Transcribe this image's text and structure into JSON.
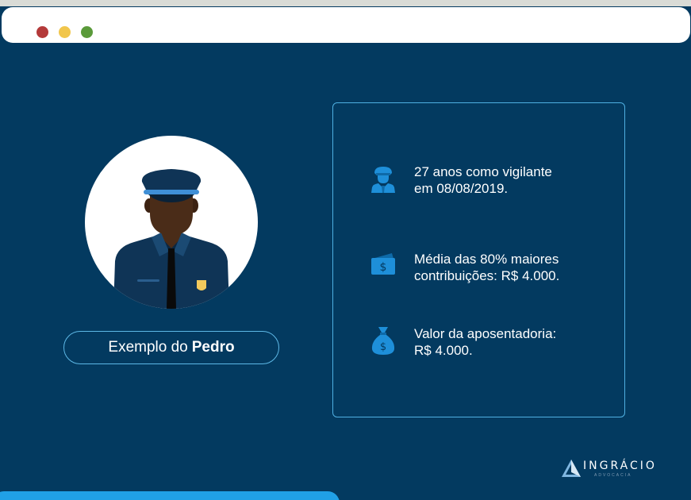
{
  "window": {
    "controls": [
      "close",
      "minimize",
      "maximize"
    ],
    "colors": {
      "close": "#b43a3a",
      "minimize": "#f1c64c",
      "maximize": "#5a9a3a"
    }
  },
  "profile": {
    "illustration": "security-guard-avatar",
    "caption_prefix": "Exemplo do",
    "caption_name": "Pedro"
  },
  "info": {
    "items": [
      {
        "icon": "guard-icon",
        "text": "27 anos como vigilante\nem 08/08/2019."
      },
      {
        "icon": "money-bill-icon",
        "text": "Média das 80% maiores\ncontribuições: R$ 4.000."
      },
      {
        "icon": "money-bag-icon",
        "text": "Valor da aposentadoria:\nR$ 4.000."
      }
    ]
  },
  "brand": {
    "name": "INGRÁCIO",
    "tagline": "ADVOCACIA"
  },
  "colors": {
    "background": "#033a60",
    "accent": "#20a0e6",
    "border": "#4fb0e2",
    "icon": "#1e8fd9"
  }
}
